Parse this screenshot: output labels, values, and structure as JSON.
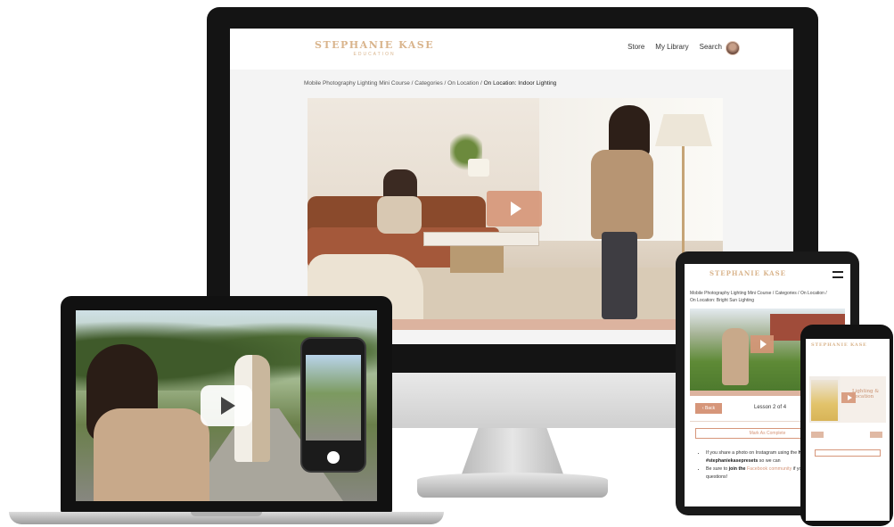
{
  "desktop": {
    "logo": {
      "main": "STEPHANIE KASE",
      "sub": "EDUCATION"
    },
    "nav": {
      "store": "Store",
      "library": "My Library",
      "search": "Search"
    },
    "breadcrumb": {
      "path": "Mobile Photography Lighting Mini Course / Categories / On Location / ",
      "current": "On Location: Indoor Lighting"
    }
  },
  "tablet": {
    "logo": "STEPHANIE KASE",
    "breadcrumb": "Mobile Photography Lighting Mini Course / Categories / On Location /",
    "current": "On Location: Bright Sun Lighting",
    "back_label": "Back",
    "lesson": "Lesson 2 of 4",
    "mark_complete": "Mark As Complete",
    "bullets": [
      {
        "pre": "If you share a photo on Instagram using the ",
        "bold": "hashtag #stephaniekasepresets",
        "post": " so we can"
      },
      {
        "pre": "Be sure to ",
        "bold": "join the",
        "link": " Facebook community",
        "post": " if you have any questions!"
      }
    ]
  },
  "phone": {
    "logo": "STEPHANIE KASE",
    "video_title": "Lighting & Location"
  },
  "colors": {
    "accent": "#d6967a",
    "logo_gold": "#d9b48c",
    "progress": "#dcb39f"
  }
}
